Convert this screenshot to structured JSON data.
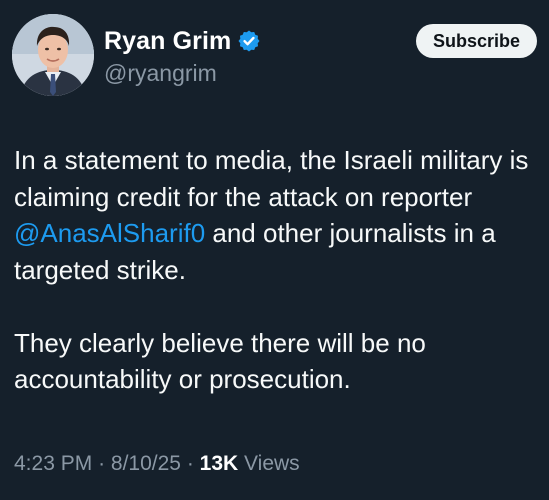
{
  "author": {
    "display_name": "Ryan Grim",
    "handle": "@ryangrim",
    "verified_icon": "verified-badge-icon"
  },
  "actions": {
    "subscribe_label": "Subscribe"
  },
  "tweet": {
    "para1_part1": "In a statement to media, the Israeli military is claiming credit for the attack on reporter ",
    "mention": "@AnasAlSharif0",
    "para1_part2": " and other journalists in a targeted strike.",
    "para2": "They clearly believe there will be no accountability or prosecution."
  },
  "meta": {
    "time": "4:23 PM",
    "separator": "·",
    "date": "8/10/25",
    "views_count": "13K",
    "views_label": "Views"
  },
  "colors": {
    "background": "#15202b",
    "link": "#1d9bf0",
    "secondary_text": "#8b98a5"
  }
}
